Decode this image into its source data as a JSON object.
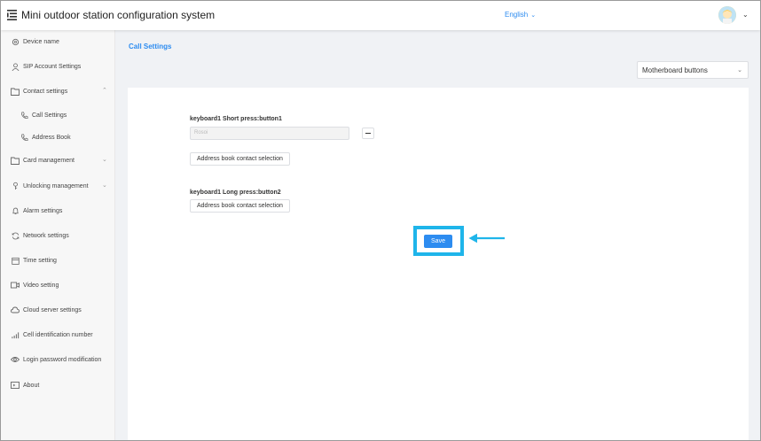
{
  "header": {
    "title": "Mini outdoor station configuration system",
    "language": "English"
  },
  "sidebar": {
    "items": [
      {
        "label": "Device name",
        "icon": "gear-icon"
      },
      {
        "label": "SIP Account Settings",
        "icon": "user-icon"
      },
      {
        "label": "Contact settings",
        "icon": "folder-icon",
        "expanded": true
      },
      {
        "label": "Call Settings",
        "icon": "phone-icon",
        "sub": true
      },
      {
        "label": "Address Book",
        "icon": "phone-icon",
        "sub": true
      },
      {
        "label": "Card management",
        "icon": "folder-icon",
        "expanded": false
      },
      {
        "label": "Unlocking management",
        "icon": "key-icon",
        "expanded": false
      },
      {
        "label": "Alarm settings",
        "icon": "bell-icon"
      },
      {
        "label": "Network settings",
        "icon": "refresh-icon"
      },
      {
        "label": "Time setting",
        "icon": "calendar-icon"
      },
      {
        "label": "Video setting",
        "icon": "video-icon"
      },
      {
        "label": "Cloud server settings",
        "icon": "cloud-icon"
      },
      {
        "label": "Cell identification number",
        "icon": "signal-icon"
      },
      {
        "label": "Login password modification",
        "icon": "eye-icon"
      },
      {
        "label": "About",
        "icon": "info-icon"
      }
    ]
  },
  "main": {
    "page_title": "Call Settings",
    "select_value": "Motherboard buttons",
    "short_press_label": "keyboard1 Short press:button1",
    "short_press_value": "Rosoi",
    "address_select_label": "Address book contact selection",
    "long_press_label": "keyboard1 Long press:button2",
    "address_select_label_2": "Address book contact selection",
    "save_label": "Save"
  },
  "colors": {
    "accent": "#2d8cf0",
    "highlight": "#1fb5ea",
    "sidebar_bg": "#f7f7f7",
    "main_bg": "#f0f2f5"
  }
}
